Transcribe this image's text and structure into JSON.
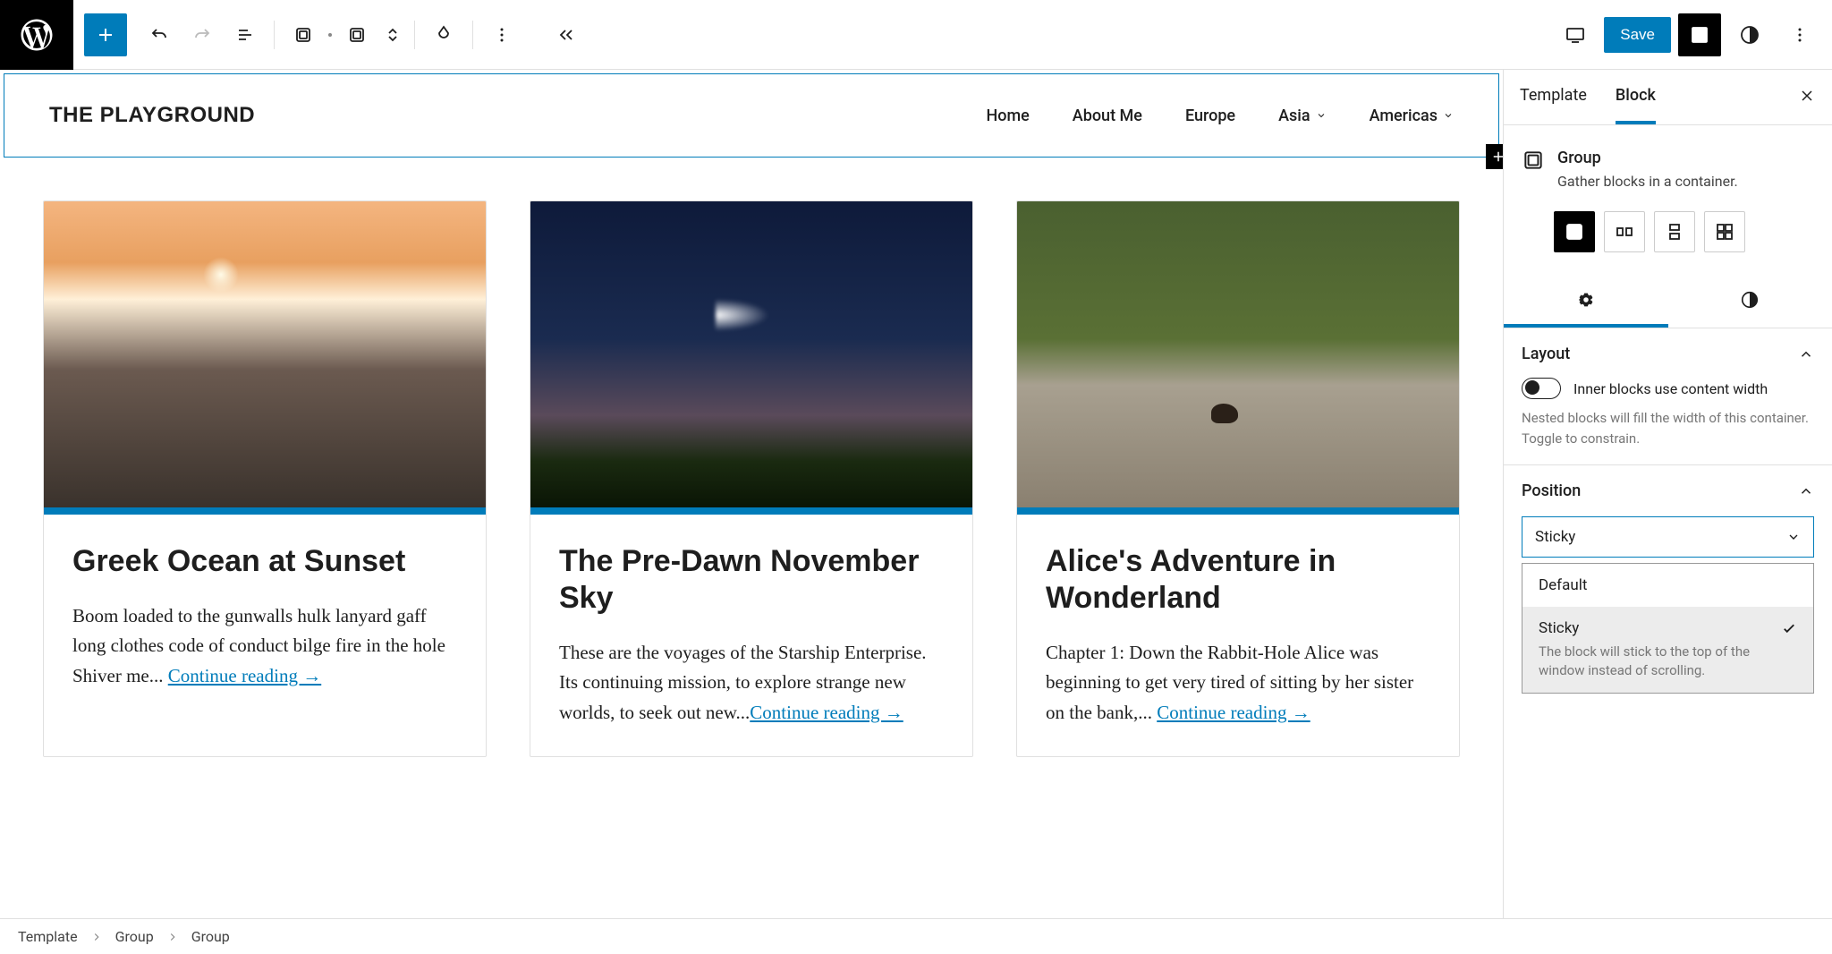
{
  "toolbar": {
    "save": "Save"
  },
  "header": {
    "site_title": "THE PLAYGROUND",
    "nav": [
      "Home",
      "About Me",
      "Europe",
      "Asia",
      "Americas"
    ],
    "nav_has_chev": [
      false,
      false,
      false,
      true,
      true
    ]
  },
  "posts": [
    {
      "title": "Greek Ocean at Sunset",
      "excerpt": "Boom loaded to the gunwalls hulk lanyard gaff long clothes code of conduct bilge fire in the hole Shiver me... ",
      "link": "Continue reading →"
    },
    {
      "title": "The Pre-Dawn November Sky",
      "excerpt": "These are the voyages of the Starship Enterprise. Its continuing mission, to explore strange new worlds, to seek out new...",
      "link": "Continue reading →"
    },
    {
      "title": "Alice's Adventure in Wonderland",
      "excerpt": "Chapter 1: Down the Rabbit-Hole Alice was beginning to get very tired of sitting by her sister on the bank,... ",
      "link": "Continue reading →"
    }
  ],
  "sidebar": {
    "tabs": [
      "Template",
      "Block"
    ],
    "block": {
      "name": "Group",
      "desc": "Gather blocks in a container."
    },
    "layout": {
      "heading": "Layout",
      "toggle_label": "Inner blocks use content width",
      "help": "Nested blocks will fill the width of this container. Toggle to constrain."
    },
    "position": {
      "heading": "Position",
      "value": "Sticky",
      "options": [
        {
          "label": "Default",
          "desc": ""
        },
        {
          "label": "Sticky",
          "desc": "The block will stick to the top of the window instead of scrolling."
        }
      ]
    }
  },
  "breadcrumb": [
    "Template",
    "Group",
    "Group"
  ]
}
